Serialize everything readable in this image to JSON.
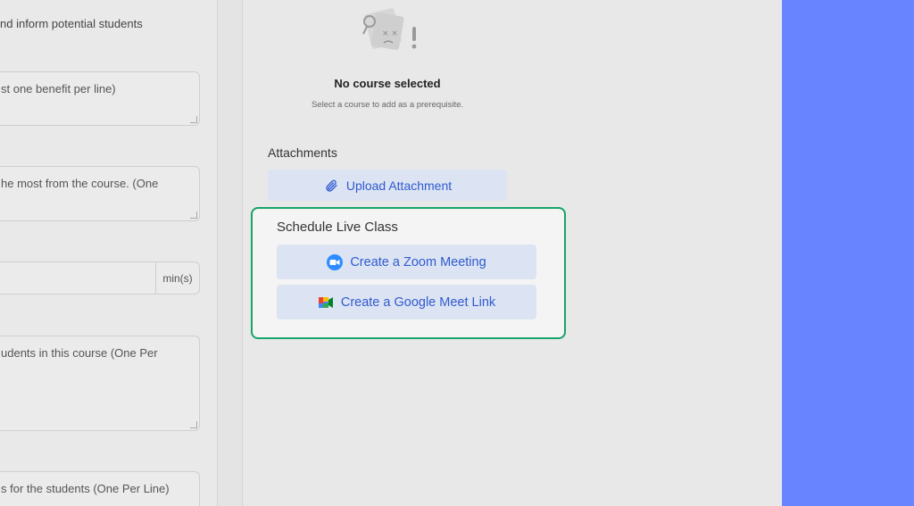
{
  "left_panel": {
    "intro_text": "nd inform potential students",
    "benefits_placeholder": "st one benefit per line)",
    "requirements_placeholder": "he most from the course. (One",
    "duration_unit": "min(s)",
    "audience_placeholder": "udents in this course (One Per",
    "materials_placeholder": "s for the students (One Per Line)"
  },
  "prerequisite": {
    "empty_title": "No course selected",
    "empty_subtitle": "Select a course to add as a prerequisite."
  },
  "attachments": {
    "title": "Attachments",
    "upload_label": "Upload Attachment"
  },
  "live_class": {
    "title": "Schedule Live Class",
    "zoom_label": "Create a Zoom Meeting",
    "meet_label": "Create a Google Meet Link"
  },
  "colors": {
    "accent": "#2f5bd0",
    "highlight_border": "#17a36a",
    "side_panel": "#6884fe"
  },
  "icons": [
    "empty-course-illustration",
    "paperclip-icon",
    "zoom-icon",
    "google-meet-icon"
  ]
}
